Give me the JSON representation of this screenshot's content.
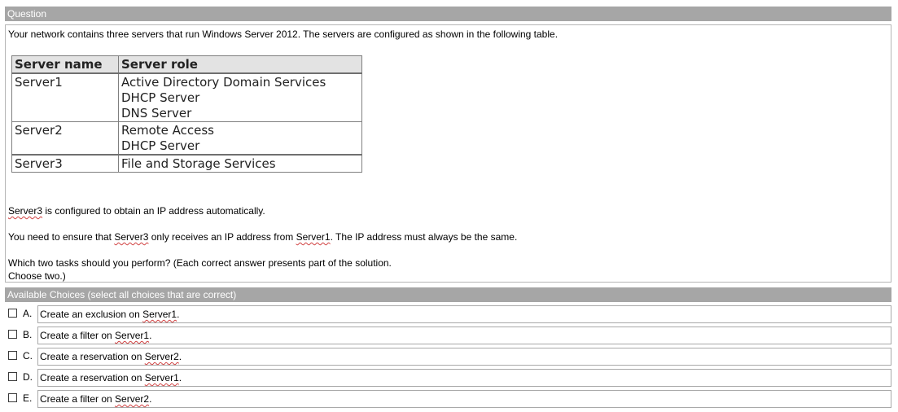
{
  "question_header": "Question",
  "question": {
    "intro": "Your network contains three servers that run Windows Server 2012. The servers are configured as shown in the following table.",
    "table": {
      "headers": [
        "Server name",
        "Server role"
      ],
      "rows": [
        {
          "name": "Server1",
          "roles": [
            "Active Directory Domain Services",
            "DHCP Server",
            "DNS Server"
          ]
        },
        {
          "name": "Server2",
          "roles": [
            "Remote Access",
            "DHCP Server"
          ]
        },
        {
          "name": "Server3",
          "roles": [
            "File and Storage Services"
          ]
        }
      ]
    },
    "line1_server": "Server3",
    "line1_rest": " is configured to obtain an IP address automatically.",
    "line2_a": "You need to ensure that ",
    "line2_server3": "Server3",
    "line2_b": " only receives an IP address from ",
    "line2_server1": "Server1",
    "line2_c": ". The IP address must always be the same.",
    "line3": "Which two tasks should you perform? (Each correct answer presents part of the solution.",
    "line4": "Choose two.)"
  },
  "choices_header": "Available Choices (select all choices that are correct)",
  "choices": [
    {
      "letter": "A.",
      "text": "Create an exclusion on ",
      "server": "Server1",
      "end": "."
    },
    {
      "letter": "B.",
      "text": "Create a filter on ",
      "server": "Server1",
      "end": "."
    },
    {
      "letter": "C.",
      "text": "Create a reservation on ",
      "server": "Server2",
      "end": "."
    },
    {
      "letter": "D.",
      "text": "Create a reservation on ",
      "server": "Server1",
      "end": "."
    },
    {
      "letter": "E.",
      "text": "Create a filter on ",
      "server": "Server2",
      "end": "."
    }
  ]
}
